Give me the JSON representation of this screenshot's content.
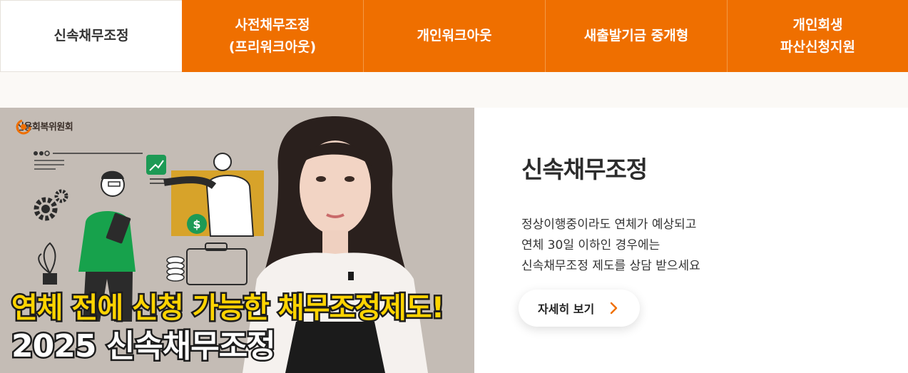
{
  "tabs": [
    {
      "lines": [
        "신속채무조정"
      ],
      "active": true
    },
    {
      "lines": [
        "사전채무조정",
        "(프리워크아웃)"
      ],
      "active": false
    },
    {
      "lines": [
        "개인워크아웃"
      ],
      "active": false
    },
    {
      "lines": [
        "새출발기금 중개형"
      ],
      "active": false
    },
    {
      "lines": [
        "개인회생",
        "파산신청지원"
      ],
      "active": false
    }
  ],
  "video": {
    "brand": "신용회복위원회",
    "caption_line1": "연체 전에 신청 가능한 채무조정제도!",
    "caption_line2": "2025 신속채무조정"
  },
  "info": {
    "title": "신속채무조정",
    "desc": [
      "정상이행중이라도 연체가 예상되고",
      "연체 30일 이하인 경우에는",
      "신속채무조정 제도를 상담 받으세요"
    ],
    "button": "자세히 보기",
    "button_icon": "chevron-right-icon"
  },
  "colors": {
    "accent": "#ef6f00",
    "caption_yellow": "#ffd400"
  }
}
